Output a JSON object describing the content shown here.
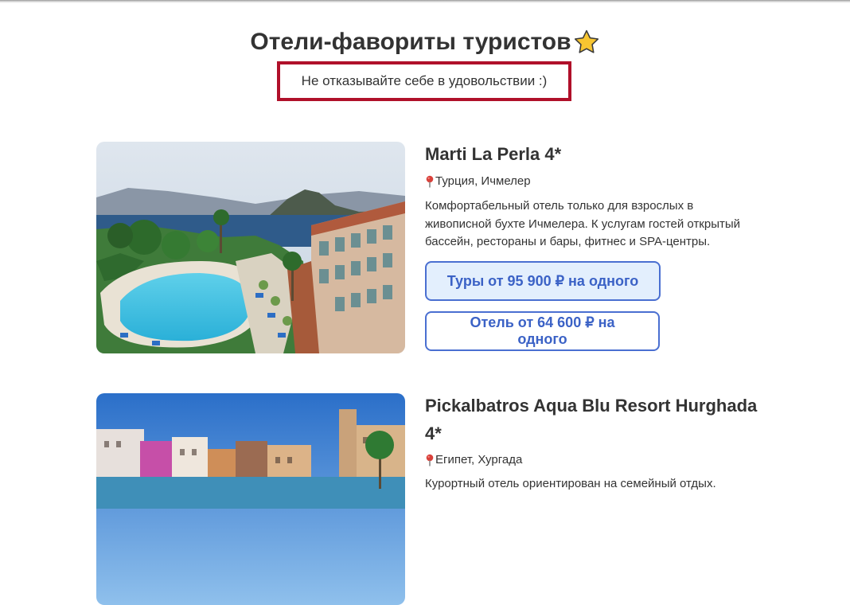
{
  "header": {
    "title": "Отели-фавориты туристов",
    "subtitle": "Не отказывайте себе в удовольствии :)"
  },
  "hotels": [
    {
      "name": "Marti La Perla 4*",
      "location": "Турция, Ичмелер",
      "description": "Комфортабельный отель только для взрослых в живописной бухте Ичмелера. К услугам гостей открытый бассейн, рестораны и бары, фитнес и SPA-центры.",
      "tours_button": "Туры от 95 900 ₽ на одного",
      "hotel_button": "Отель от 64 600 ₽ на одного"
    },
    {
      "name": "Pickalbatros Aqua Blu Resort Hurghada 4*",
      "location": "Египет, Хургада",
      "description": "Курортный отель ориентирован на семейный отдых."
    }
  ],
  "colors": {
    "accent_border": "#b0102a",
    "button_text": "#3b62c6",
    "button_fill": "#e3effd"
  },
  "icons": {
    "title_icon": "star-icon",
    "location_icon": "pin-icon"
  }
}
